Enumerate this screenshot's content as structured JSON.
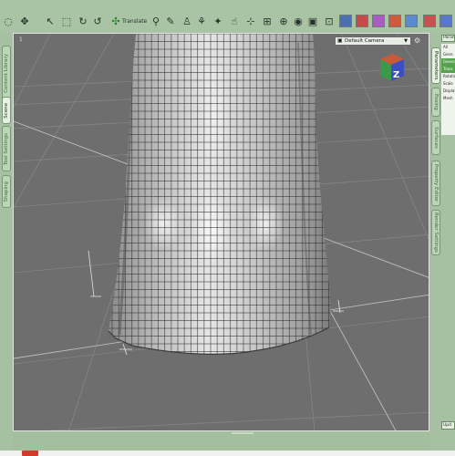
{
  "toolbar": {
    "translate_label": "Translate",
    "icons": [
      "select-icon",
      "translate-icon",
      "rotate-icon",
      "scale-icon",
      "spot-render-icon",
      "camera-icon",
      "render-icon"
    ]
  },
  "left_panel": {
    "tabs": [
      {
        "label": "Content Library",
        "active": false
      },
      {
        "label": "Scene",
        "active": true
      },
      {
        "label": "Tool Settings",
        "active": false
      },
      {
        "label": "Shaping",
        "active": false
      }
    ]
  },
  "right_panel": {
    "tabs": [
      {
        "label": "Parameters",
        "active": true
      },
      {
        "label": "Posing",
        "active": false
      },
      {
        "label": "Surfaces",
        "active": false
      },
      {
        "label": "Property Editor",
        "active": false
      },
      {
        "label": "Render Settings",
        "active": false
      }
    ],
    "header": "Parameters",
    "items": [
      "All",
      "Gene",
      "General",
      "Trans",
      "Rotation",
      "Scale",
      "Display",
      "Mesh"
    ],
    "apply_label": "Upd"
  },
  "viewport": {
    "label": "1",
    "camera_dropdown": "Default Camera",
    "view_cube_letter": "Z"
  },
  "colors": {
    "ui_green": "#9db89a",
    "viewport_bg": "#6e6e6e",
    "selection": "#54a24c"
  }
}
